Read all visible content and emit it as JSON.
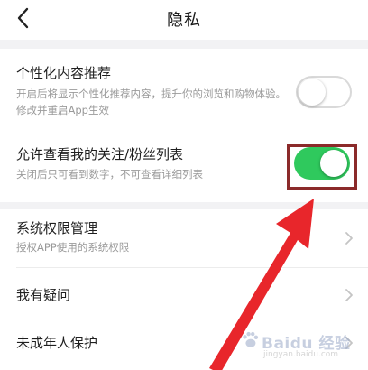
{
  "header": {
    "title": "隐私",
    "back_icon": "chevron-left-icon"
  },
  "settings": [
    {
      "title": "个性化内容推荐",
      "description": "开启后将显示个性化推荐内容，提升你的浏览和购物体验。修改并重启App生效",
      "toggle": "off"
    },
    {
      "title": "允许查看我的关注/粉丝列表",
      "description": "关闭后只可看到数字，不可查看详细列表",
      "toggle": "on"
    }
  ],
  "menu": [
    {
      "title": "系统权限管理",
      "description": "授权APP使用的系统权限"
    },
    {
      "title": "我有疑问"
    },
    {
      "title": "未成年人保护"
    }
  ],
  "watermark": {
    "text": "Baidu 经验",
    "subtext": "jingyan.baidu.com"
  },
  "colors": {
    "toggle_on": "#2fc95d",
    "toggle_off_border": "#d9d9d9",
    "highlight_box": "#8b2a2a",
    "arrow": "#e8262b",
    "secondary_text": "#9a9a9a",
    "divider": "#ececec"
  }
}
